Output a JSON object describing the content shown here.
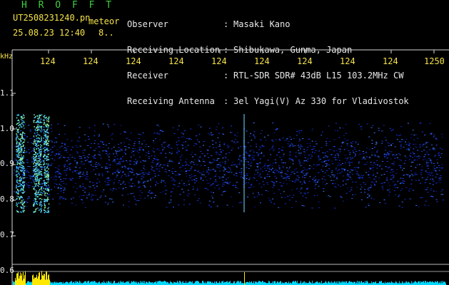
{
  "header": {
    "brand": "H R O F F T",
    "filename": "UT2508231240.pn",
    "detection": "meteor",
    "datetime": "25.08.23 12:40",
    "count": "8..",
    "info": [
      {
        "label": "Observer",
        "value": "Masaki Kano"
      },
      {
        "label": "Receiving Location",
        "value": "Shibukawa, Gunma, Japan"
      },
      {
        "label": "Receiver",
        "value": "RTL-SDR SDR# 43dB L15 103.2MHz CW"
      },
      {
        "label": "Receiving Antenna",
        "value": "3el Yagi(V) Az 330 for Vladivostok"
      }
    ]
  },
  "axes": {
    "y_unit": "kHz",
    "x_ticks": [
      "124",
      "124",
      "124",
      "124",
      "124",
      "124",
      "124",
      "124",
      "124",
      "1250"
    ],
    "y_ticks": [
      "1.1",
      "1.0",
      "0.9",
      "0.8",
      "0.7",
      "0.6"
    ]
  },
  "colors": {
    "background": "#000000",
    "text_header": "#f4e24a",
    "text_info": "#e8e8e8",
    "brand": "#3fd03f",
    "noise_band": "#1a3cff",
    "meteor_echo": "#7fffbf",
    "level_bar": "#00d8ff",
    "level_peak": "#ffe800"
  }
}
